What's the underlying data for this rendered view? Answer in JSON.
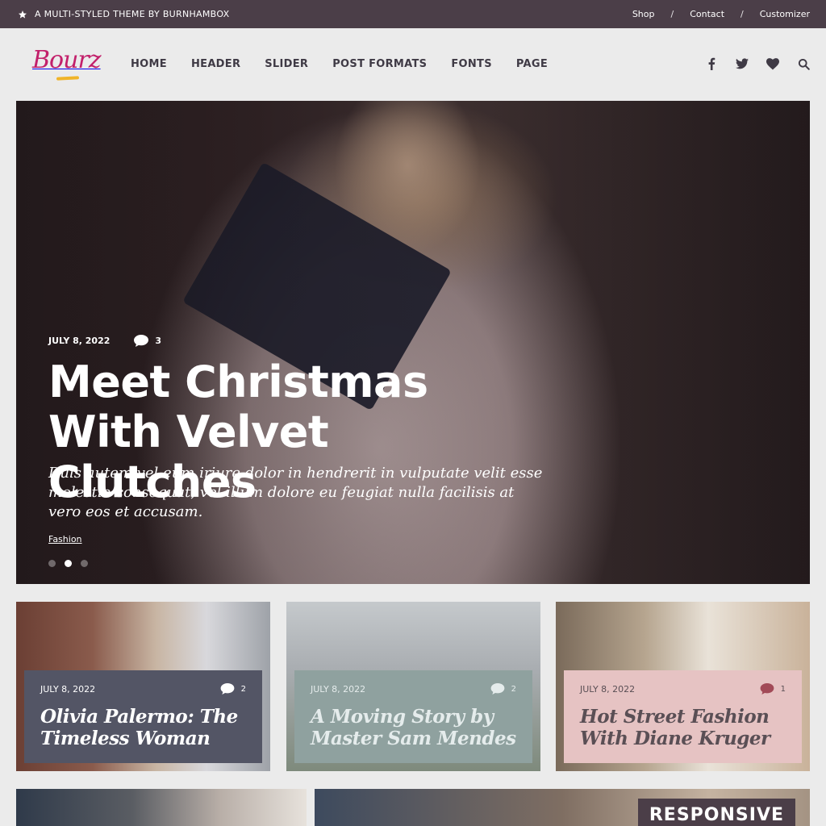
{
  "topbar": {
    "tagline": "A MULTI-STYLED THEME BY BURNHAMBOX",
    "links": [
      "Shop",
      "Contact",
      "Customizer"
    ],
    "separator": "/"
  },
  "header": {
    "logo_text": "Bourz",
    "nav": [
      "HOME",
      "HEADER",
      "SLIDER",
      "POST FORMATS",
      "FONTS",
      "PAGE"
    ],
    "social_icons": [
      "facebook-icon",
      "twitter-icon",
      "heart-icon",
      "search-icon"
    ]
  },
  "hero": {
    "date": "JULY 8, 2022",
    "comments": "3",
    "title": "Meet Christmas With Velvet Clutches",
    "excerpt": "Duis autem vel eum iriure dolor in hendrerit in vulputate velit esse molestie consequat, vel illum dolore eu feugiat nulla facilisis at vero eos et accusam.",
    "category": "Fashion",
    "slides": 3,
    "active_slide": 2
  },
  "cards": [
    {
      "date": "JULY 8, 2022",
      "comments": "2",
      "title": "Olivia Palermo: The Timeless Woman",
      "panel_color": "#535565"
    },
    {
      "date": "JULY 8, 2022",
      "comments": "2",
      "title": "A Moving Story by Master Sam Mendes",
      "panel_color": "#8fa19f"
    },
    {
      "date": "JULY 8, 2022",
      "comments": "1",
      "title": "Hot Street Fashion With Diane Kruger",
      "panel_color": "#e6c3c3"
    }
  ],
  "bottom": {
    "badge": "RESPONSIVE"
  },
  "colors": {
    "topbar": "#4b3e48",
    "accent": "#c2206b",
    "logo_underline": "#f0b429",
    "background": "#ebebeb"
  }
}
